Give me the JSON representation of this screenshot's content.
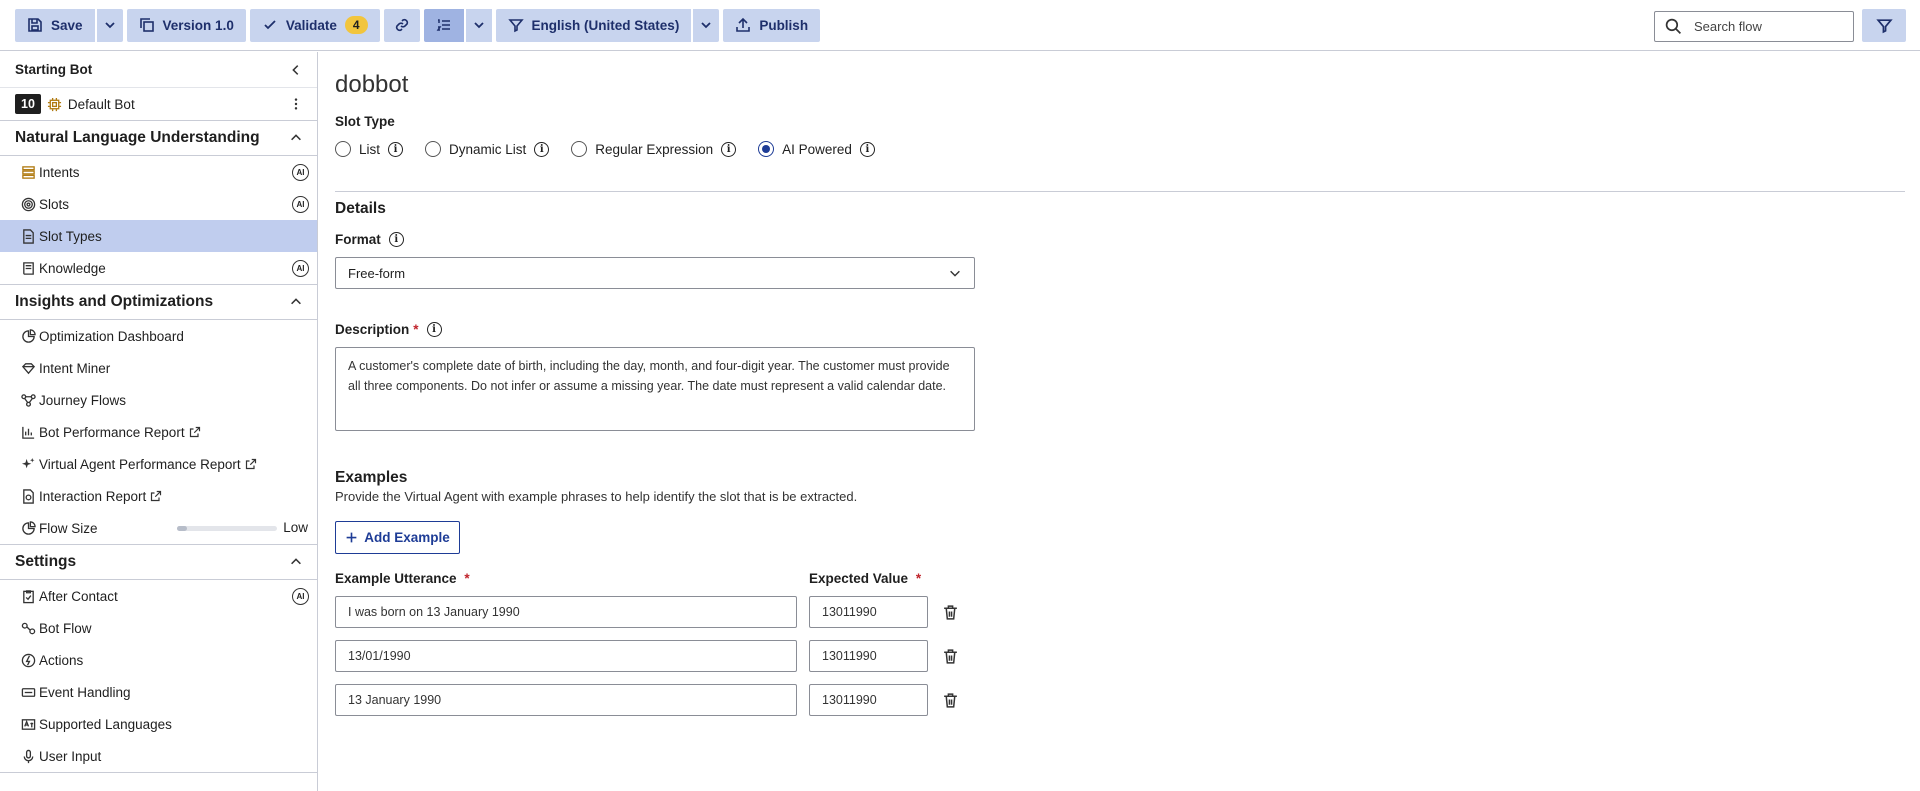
{
  "toolbar": {
    "save_label": "Save",
    "version_label": "Version 1.0",
    "validate_label": "Validate",
    "validate_count": "4",
    "language_label": "English (United States)",
    "publish_label": "Publish",
    "search_placeholder": "Search flow"
  },
  "sidebar": {
    "header": "Starting Bot",
    "bot": {
      "number": "10",
      "name": "Default Bot"
    },
    "sections": {
      "nlu": {
        "title": "Natural Language Understanding",
        "items": [
          {
            "label": "Intents",
            "icon": "intents-icon",
            "ai": "AI"
          },
          {
            "label": "Slots",
            "icon": "slots-icon",
            "ai": "AI"
          },
          {
            "label": "Slot Types",
            "icon": "document-icon",
            "selected": true
          },
          {
            "label": "Knowledge",
            "icon": "book-icon",
            "ai": "AI"
          }
        ]
      },
      "insights": {
        "title": "Insights and Optimizations",
        "items": [
          {
            "label": "Optimization Dashboard",
            "icon": "dashboard-icon"
          },
          {
            "label": "Intent Miner",
            "icon": "gem-icon"
          },
          {
            "label": "Journey Flows",
            "icon": "flow-icon"
          },
          {
            "label": "Bot Performance Report",
            "icon": "chart-icon",
            "external": true
          },
          {
            "label": "Virtual Agent Performance Report",
            "icon": "sparkle-icon",
            "external": true
          },
          {
            "label": "Interaction Report",
            "icon": "report-icon",
            "external": true
          }
        ],
        "flow_size": {
          "label": "Flow Size",
          "value_label": "Low",
          "level": 0.1
        }
      },
      "settings": {
        "title": "Settings",
        "items": [
          {
            "label": "After Contact",
            "icon": "clipboard-icon",
            "ai": "AI"
          },
          {
            "label": "Bot Flow",
            "icon": "botflow-icon"
          },
          {
            "label": "Actions",
            "icon": "actions-icon"
          },
          {
            "label": "Event Handling",
            "icon": "event-icon"
          },
          {
            "label": "Supported Languages",
            "icon": "language-icon"
          },
          {
            "label": "User Input",
            "icon": "microphone-icon"
          }
        ]
      }
    }
  },
  "main": {
    "title": "dobbot",
    "slot_type_label": "Slot Type",
    "slot_type_options": [
      {
        "label": "List",
        "selected": false
      },
      {
        "label": "Dynamic List",
        "selected": false
      },
      {
        "label": "Regular Expression",
        "selected": false
      },
      {
        "label": "AI Powered",
        "selected": true
      }
    ],
    "details_title": "Details",
    "format_label": "Format",
    "format_value": "Free-form",
    "description_label": "Description",
    "required_mark": "*",
    "description_value": "A customer's complete date of birth, including the day, month, and four-digit year. The customer must provide all three components. Do not infer or assume a missing year. The date must represent a valid calendar date.",
    "examples_title": "Examples",
    "examples_subtitle": "Provide the Virtual Agent with example phrases to help identify the slot that is be extracted.",
    "add_example_label": "Add Example",
    "col_utterance": "Example Utterance",
    "col_expected": "Expected Value",
    "examples": [
      {
        "utterance": "I was born on 13 January 1990",
        "value": "13011990"
      },
      {
        "utterance": "13/01/1990",
        "value": "13011990"
      },
      {
        "utterance": "13 January 1990",
        "value": "13011990"
      }
    ]
  }
}
